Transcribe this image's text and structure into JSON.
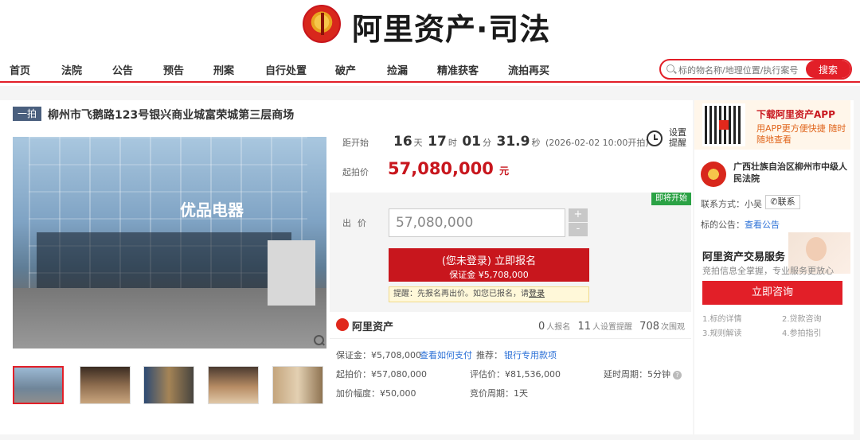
{
  "header": {
    "logo_text": "阿里资产·司法",
    "nav": [
      "首页",
      "法院",
      "公告",
      "预告",
      "刑案",
      "自行处置",
      "破产",
      "捡漏",
      "精准获客",
      "流拍再买"
    ],
    "search_placeholder": "标的物名称/地理位置/执行案号",
    "search_button": "搜索"
  },
  "item": {
    "round_tag": "一拍",
    "title": "柳州市飞鹅路123号银兴商业城富荣城第三层商场",
    "photo_sign": "优品电器"
  },
  "auction": {
    "countdown_label": "距开始",
    "days": "16",
    "days_unit": "天",
    "hours": "17",
    "hours_unit": "时",
    "minutes": "01",
    "minutes_unit": "分",
    "seconds": "31.9",
    "seconds_unit": "秒",
    "start_time": "(2026-02-02 10:00开拍)",
    "remind_label": "设置提醒",
    "start_price_label": "起拍价",
    "start_price": "57,080,000",
    "currency_unit": "元",
    "status_badge": "即将开始",
    "bid_label": "出价",
    "bid_value": "57,080,000",
    "plus": "+",
    "minus": "-",
    "signup_line1": "(您未登录) 立即报名",
    "signup_line2": "保证金 ¥5,708,000",
    "tip_text": "提醒：先报名再出价。如您已报名，请",
    "tip_link": "登录"
  },
  "stats": {
    "platform": "阿里资产",
    "signed_count": "0",
    "signed_label": "人报名",
    "reminder_count": "11",
    "reminder_label": "人设置提醒",
    "view_count": "708",
    "view_label": "次围观"
  },
  "details": {
    "deposit": "保证金：¥5,708,000",
    "how_to_pay": "查看如何支付",
    "recommend": "推荐：",
    "bank_fund": "银行专用款项",
    "start_price": "起拍价：¥57,080,000",
    "appraisal": "评估价：¥81,536,000",
    "delay": "延时周期：5分钟",
    "increment": "加价幅度：¥50,000",
    "bid_cycle": "竞价周期：1天"
  },
  "sidebar": {
    "app_title": "下载阿里资产APP",
    "app_sub": "用APP更方便快捷 随时随地查看",
    "court_name": "广西壮族自治区柳州市中级人民法院",
    "contact_label": "联系方式：小吴",
    "contact_button": "联系",
    "notice_label": "标的公告：",
    "notice_link": "查看公告",
    "service_title": "阿里资产交易服务",
    "service_sub": "竞拍信息全掌握，专业服务更放心",
    "consult_button": "立即咨询",
    "links": [
      "1.标的详情",
      "2.贷款咨询",
      "3.规则解读",
      "4.参拍指引"
    ]
  }
}
